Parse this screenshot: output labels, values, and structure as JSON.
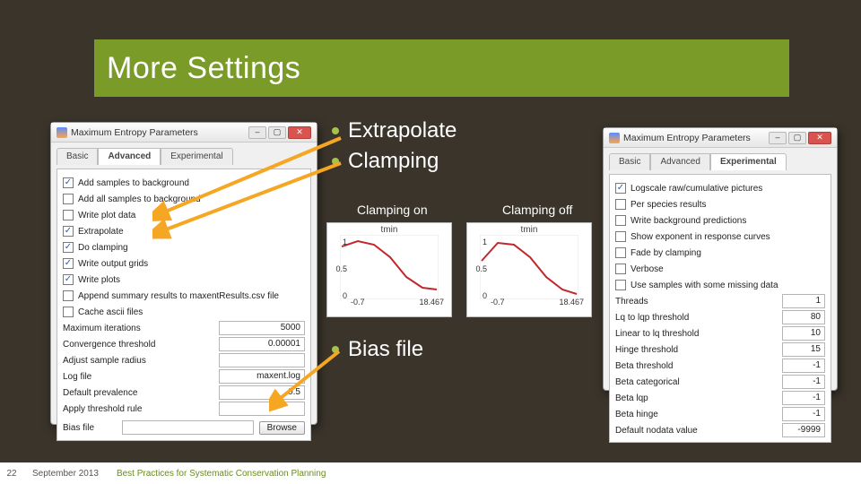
{
  "title": "More Settings",
  "bullets_top": [
    "Extrapolate",
    "Clamping"
  ],
  "chart_on_label": "Clamping on",
  "chart_off_label": "Clamping off",
  "bullet_bottom": "Bias file",
  "footer": {
    "page": "22",
    "date": "September 2013",
    "text": "Best Practices for Systematic Conservation Planning"
  },
  "dlg_left": {
    "title": "Maximum Entropy Parameters",
    "tabs": [
      "Basic",
      "Advanced",
      "Experimental"
    ],
    "active_tab": 1,
    "checks": [
      {
        "label": "Add samples to background",
        "checked": true
      },
      {
        "label": "Add all samples to background",
        "checked": false
      },
      {
        "label": "Write plot data",
        "checked": false
      },
      {
        "label": "Extrapolate",
        "checked": true
      },
      {
        "label": "Do clamping",
        "checked": true
      },
      {
        "label": "Write output grids",
        "checked": true
      },
      {
        "label": "Write plots",
        "checked": true
      },
      {
        "label": "Append summary results to maxentResults.csv file",
        "checked": false
      },
      {
        "label": "Cache ascii files",
        "checked": false
      }
    ],
    "vals": [
      {
        "label": "Maximum iterations",
        "value": "5000"
      },
      {
        "label": "Convergence threshold",
        "value": "0.00001"
      },
      {
        "label": "Adjust sample radius",
        "value": ""
      },
      {
        "label": "Log file",
        "value": "maxent.log"
      },
      {
        "label": "Default prevalence",
        "value": "0.5"
      },
      {
        "label": "Apply threshold rule",
        "value": ""
      }
    ],
    "bias": {
      "label": "Bias file",
      "browse": "Browse"
    }
  },
  "dlg_right": {
    "title": "Maximum Entropy Parameters",
    "tabs": [
      "Basic",
      "Advanced",
      "Experimental"
    ],
    "active_tab": 2,
    "checks": [
      {
        "label": "Logscale raw/cumulative pictures",
        "checked": true
      },
      {
        "label": "Per species results",
        "checked": false
      },
      {
        "label": "Write background predictions",
        "checked": false
      },
      {
        "label": "Show exponent in response curves",
        "checked": false
      },
      {
        "label": "Fade by clamping",
        "checked": false
      },
      {
        "label": "Verbose",
        "checked": false
      },
      {
        "label": "Use samples with some missing data",
        "checked": false
      }
    ],
    "vals": [
      {
        "label": "Threads",
        "value": "1"
      },
      {
        "label": "Lq to lqp threshold",
        "value": "80"
      },
      {
        "label": "Linear to lq threshold",
        "value": "10"
      },
      {
        "label": "Hinge threshold",
        "value": "15"
      },
      {
        "label": "Beta threshold",
        "value": "-1"
      },
      {
        "label": "Beta categorical",
        "value": "-1"
      },
      {
        "label": "Beta lqp",
        "value": "-1"
      },
      {
        "label": "Beta hinge",
        "value": "-1"
      },
      {
        "label": "Default nodata value",
        "value": "-9999"
      }
    ]
  },
  "chart_data": [
    {
      "type": "line",
      "title": "tmin",
      "label": "Clamping on",
      "x": [
        -0.7,
        3,
        6,
        9,
        12,
        15,
        18.467
      ],
      "y": [
        0.82,
        0.9,
        0.85,
        0.65,
        0.35,
        0.18,
        0.15
      ],
      "xlim": [
        -0.7,
        18.467
      ],
      "ylim": [
        0.0,
        1.0
      ],
      "yticks": [
        0.0,
        0.5,
        1.0
      ],
      "xticks": [
        -0.7,
        18.467
      ]
    },
    {
      "type": "line",
      "title": "tmin",
      "label": "Clamping off",
      "x": [
        -0.7,
        3,
        6,
        9,
        12,
        15,
        18.467
      ],
      "y": [
        0.6,
        0.88,
        0.85,
        0.65,
        0.35,
        0.15,
        0.08
      ],
      "xlim": [
        -0.7,
        18.467
      ],
      "ylim": [
        0.0,
        1.0
      ],
      "yticks": [
        0.0,
        0.5,
        1.0
      ],
      "xticks": [
        -0.7,
        18.467
      ]
    }
  ]
}
